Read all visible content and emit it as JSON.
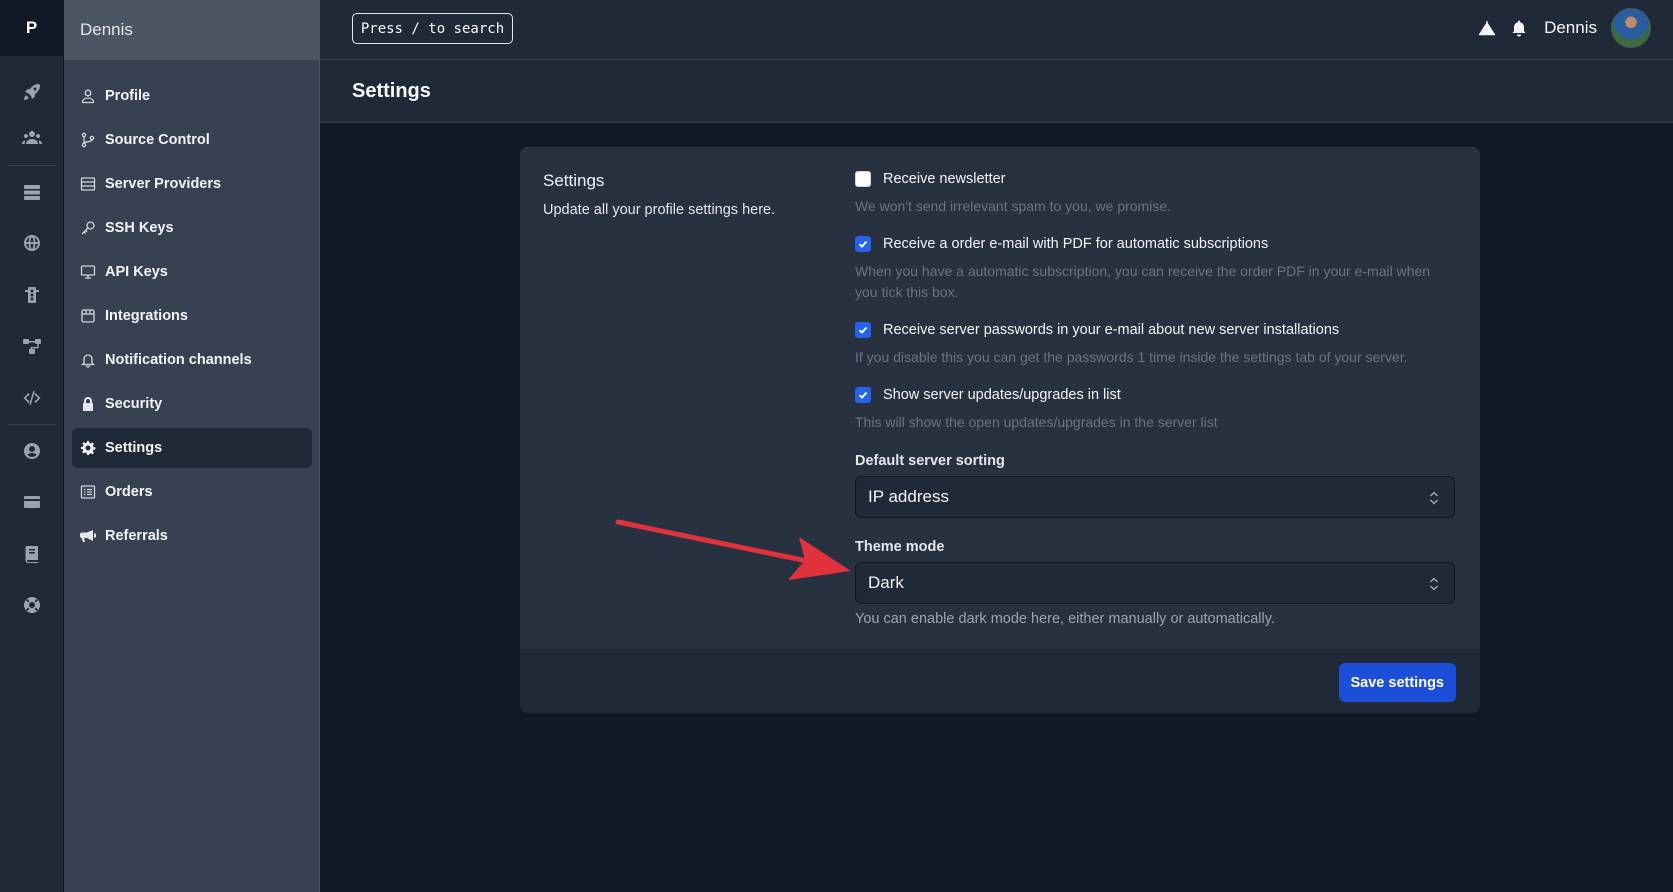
{
  "rail": {
    "logo": "P",
    "icons": [
      "rocket-icon",
      "users-icon",
      "server-stack-icon",
      "globe-icon",
      "traffic-light-icon",
      "network-icon",
      "code-icon",
      "user-circle-icon",
      "credit-card-icon",
      "book-icon",
      "lifebuoy-icon"
    ]
  },
  "sidebar": {
    "header": "Dennis",
    "items": [
      {
        "label": "Profile",
        "icon": "user-icon"
      },
      {
        "label": "Source Control",
        "icon": "git-branch-icon"
      },
      {
        "label": "Server Providers",
        "icon": "server-icon"
      },
      {
        "label": "SSH Keys",
        "icon": "key-icon"
      },
      {
        "label": "API Keys",
        "icon": "monitor-icon"
      },
      {
        "label": "Integrations",
        "icon": "puzzle-icon"
      },
      {
        "label": "Notification channels",
        "icon": "bell-icon"
      },
      {
        "label": "Security",
        "icon": "lock-icon"
      },
      {
        "label": "Settings",
        "icon": "gear-icon",
        "active": true
      },
      {
        "label": "Orders",
        "icon": "list-icon"
      },
      {
        "label": "Referrals",
        "icon": "megaphone-icon"
      }
    ]
  },
  "topbar": {
    "search_hint": "Press / to search",
    "user_name": "Dennis"
  },
  "page": {
    "title": "Settings"
  },
  "settings": {
    "section_title": "Settings",
    "section_description": "Update all your profile settings here.",
    "options": [
      {
        "label": "Receive newsletter",
        "checked": false,
        "help": "We won't send irrelevant spam to you, we promise."
      },
      {
        "label": "Receive a order e-mail with PDF for automatic subscriptions",
        "checked": true,
        "help": "When you have a automatic subscription, you can receive the order PDF in your e-mail when you tick this box."
      },
      {
        "label": "Receive server passwords in your e-mail about new server installations",
        "checked": true,
        "help": "If you disable this you can get the passwords 1 time inside the settings tab of your server."
      },
      {
        "label": "Show server updates/upgrades in list",
        "checked": true,
        "help": "This will show the open updates/upgrades in the server list"
      }
    ],
    "sorting_label": "Default server sorting",
    "sorting_value": "IP address",
    "theme_label": "Theme mode",
    "theme_value": "Dark",
    "theme_help": "You can enable dark mode here, either manually or automatically.",
    "save_label": "Save settings"
  },
  "colors": {
    "accent": "#1d4ed8",
    "checkbox": "#2563eb",
    "annotation_arrow": "#e0323c"
  }
}
